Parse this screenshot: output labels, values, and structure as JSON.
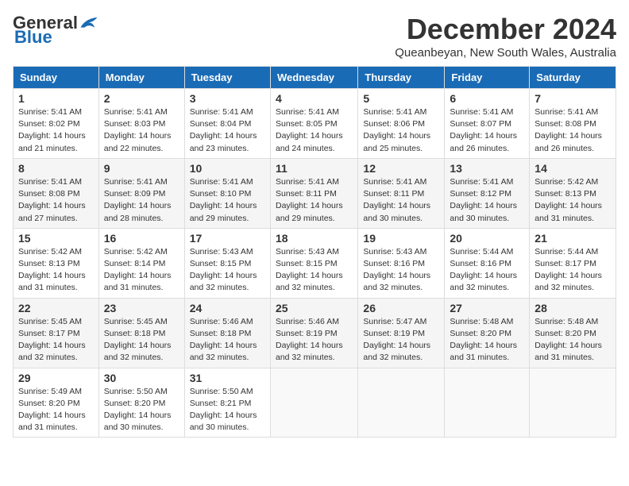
{
  "logo": {
    "general": "General",
    "blue": "Blue"
  },
  "title": "December 2024",
  "location": "Queanbeyan, New South Wales, Australia",
  "days_of_week": [
    "Sunday",
    "Monday",
    "Tuesday",
    "Wednesday",
    "Thursday",
    "Friday",
    "Saturday"
  ],
  "weeks": [
    [
      {
        "day": "1",
        "sunrise": "5:41 AM",
        "sunset": "8:02 PM",
        "daylight": "14 hours and 21 minutes."
      },
      {
        "day": "2",
        "sunrise": "5:41 AM",
        "sunset": "8:03 PM",
        "daylight": "14 hours and 22 minutes."
      },
      {
        "day": "3",
        "sunrise": "5:41 AM",
        "sunset": "8:04 PM",
        "daylight": "14 hours and 23 minutes."
      },
      {
        "day": "4",
        "sunrise": "5:41 AM",
        "sunset": "8:05 PM",
        "daylight": "14 hours and 24 minutes."
      },
      {
        "day": "5",
        "sunrise": "5:41 AM",
        "sunset": "8:06 PM",
        "daylight": "14 hours and 25 minutes."
      },
      {
        "day": "6",
        "sunrise": "5:41 AM",
        "sunset": "8:07 PM",
        "daylight": "14 hours and 26 minutes."
      },
      {
        "day": "7",
        "sunrise": "5:41 AM",
        "sunset": "8:08 PM",
        "daylight": "14 hours and 26 minutes."
      }
    ],
    [
      {
        "day": "8",
        "sunrise": "5:41 AM",
        "sunset": "8:08 PM",
        "daylight": "14 hours and 27 minutes."
      },
      {
        "day": "9",
        "sunrise": "5:41 AM",
        "sunset": "8:09 PM",
        "daylight": "14 hours and 28 minutes."
      },
      {
        "day": "10",
        "sunrise": "5:41 AM",
        "sunset": "8:10 PM",
        "daylight": "14 hours and 29 minutes."
      },
      {
        "day": "11",
        "sunrise": "5:41 AM",
        "sunset": "8:11 PM",
        "daylight": "14 hours and 29 minutes."
      },
      {
        "day": "12",
        "sunrise": "5:41 AM",
        "sunset": "8:11 PM",
        "daylight": "14 hours and 30 minutes."
      },
      {
        "day": "13",
        "sunrise": "5:41 AM",
        "sunset": "8:12 PM",
        "daylight": "14 hours and 30 minutes."
      },
      {
        "day": "14",
        "sunrise": "5:42 AM",
        "sunset": "8:13 PM",
        "daylight": "14 hours and 31 minutes."
      }
    ],
    [
      {
        "day": "15",
        "sunrise": "5:42 AM",
        "sunset": "8:13 PM",
        "daylight": "14 hours and 31 minutes."
      },
      {
        "day": "16",
        "sunrise": "5:42 AM",
        "sunset": "8:14 PM",
        "daylight": "14 hours and 31 minutes."
      },
      {
        "day": "17",
        "sunrise": "5:43 AM",
        "sunset": "8:15 PM",
        "daylight": "14 hours and 32 minutes."
      },
      {
        "day": "18",
        "sunrise": "5:43 AM",
        "sunset": "8:15 PM",
        "daylight": "14 hours and 32 minutes."
      },
      {
        "day": "19",
        "sunrise": "5:43 AM",
        "sunset": "8:16 PM",
        "daylight": "14 hours and 32 minutes."
      },
      {
        "day": "20",
        "sunrise": "5:44 AM",
        "sunset": "8:16 PM",
        "daylight": "14 hours and 32 minutes."
      },
      {
        "day": "21",
        "sunrise": "5:44 AM",
        "sunset": "8:17 PM",
        "daylight": "14 hours and 32 minutes."
      }
    ],
    [
      {
        "day": "22",
        "sunrise": "5:45 AM",
        "sunset": "8:17 PM",
        "daylight": "14 hours and 32 minutes."
      },
      {
        "day": "23",
        "sunrise": "5:45 AM",
        "sunset": "8:18 PM",
        "daylight": "14 hours and 32 minutes."
      },
      {
        "day": "24",
        "sunrise": "5:46 AM",
        "sunset": "8:18 PM",
        "daylight": "14 hours and 32 minutes."
      },
      {
        "day": "25",
        "sunrise": "5:46 AM",
        "sunset": "8:19 PM",
        "daylight": "14 hours and 32 minutes."
      },
      {
        "day": "26",
        "sunrise": "5:47 AM",
        "sunset": "8:19 PM",
        "daylight": "14 hours and 32 minutes."
      },
      {
        "day": "27",
        "sunrise": "5:48 AM",
        "sunset": "8:20 PM",
        "daylight": "14 hours and 31 minutes."
      },
      {
        "day": "28",
        "sunrise": "5:48 AM",
        "sunset": "8:20 PM",
        "daylight": "14 hours and 31 minutes."
      }
    ],
    [
      {
        "day": "29",
        "sunrise": "5:49 AM",
        "sunset": "8:20 PM",
        "daylight": "14 hours and 31 minutes."
      },
      {
        "day": "30",
        "sunrise": "5:50 AM",
        "sunset": "8:20 PM",
        "daylight": "14 hours and 30 minutes."
      },
      {
        "day": "31",
        "sunrise": "5:50 AM",
        "sunset": "8:21 PM",
        "daylight": "14 hours and 30 minutes."
      },
      null,
      null,
      null,
      null
    ]
  ]
}
